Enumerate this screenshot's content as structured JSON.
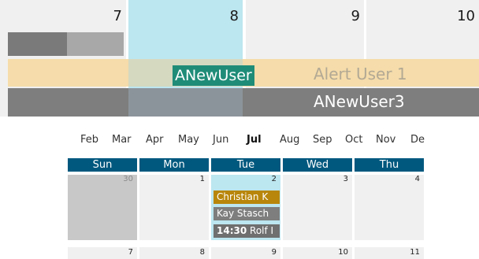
{
  "timeline": {
    "days": [
      "7",
      "8",
      "9",
      "10"
    ],
    "events": {
      "anew": "ANewUser",
      "alert": "Alert User 1",
      "anew3": "ANewUser3"
    }
  },
  "months": [
    "Feb",
    "Mar",
    "Apr",
    "May",
    "Jun",
    "Jul",
    "Aug",
    "Sep",
    "Oct",
    "Nov",
    "De"
  ],
  "month_grid": {
    "weekdays": [
      "Sun",
      "Mon",
      "Tue",
      "Wed",
      "Thu"
    ],
    "week1": [
      "30",
      "1",
      "2",
      "3",
      "4"
    ],
    "week2": [
      "7",
      "8",
      "9",
      "10",
      "11"
    ],
    "events": {
      "e1": "Christian K",
      "e2": "Kay Stasch",
      "e3_time": "14:30",
      "e3_name": "Rolf I"
    }
  },
  "colors": {
    "today_highlight": "#bce6f0",
    "weekday_header": "#00587e",
    "event_green": "#1f8c78",
    "event_gold": "#b8860b",
    "event_gray": "#7e7e7e"
  }
}
